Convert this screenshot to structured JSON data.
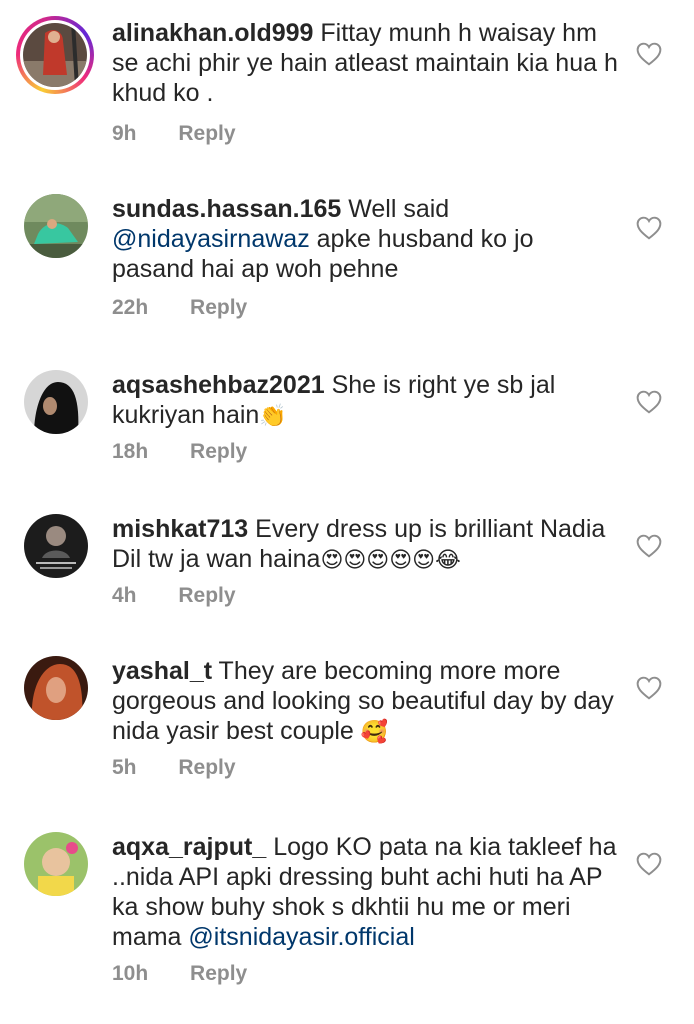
{
  "comments": [
    {
      "username": "alinakhan.old999",
      "text": " Fittay munh h waisay hm se achi phir ye hain atleast maintain kia hua h khud ko .",
      "time": "9h",
      "reply": "Reply",
      "avatar_colors": [
        "#3b2f2a",
        "#c0392b"
      ]
    },
    {
      "username": "sundas.hassan.165",
      "text_before": " Well said ",
      "mention": "@nidayasirnawaz",
      "text_after": " apke husband ko jo pasand hai ap woh pehne",
      "time": "22h",
      "reply": "Reply",
      "avatar_colors": [
        "#4e6b4a",
        "#38c7a0"
      ]
    },
    {
      "username": "aqsashehbaz2021",
      "text": " She is right ye sb jal kukriyan hain",
      "emoji": "👏",
      "time": "18h",
      "reply": "Reply",
      "avatar_colors": [
        "#cfcfcf",
        "#111111"
      ]
    },
    {
      "username": "mishkat713",
      "text": " Every dress up is brilliant Nadia Dil tw ja wan haina",
      "emoji": "😍😍😍😍😍😂",
      "time": "4h",
      "reply": "Reply",
      "avatar_colors": [
        "#1c1c1c",
        "#8a8a8a"
      ]
    },
    {
      "username": "yashal_t",
      "text": " They are becoming more more gorgeous and looking so beautiful day by day nida yasir best couple ",
      "emoji": "🥰",
      "time": "5h",
      "reply": "Reply",
      "avatar_colors": [
        "#5a2a1a",
        "#c0532b"
      ]
    },
    {
      "username": "aqxa_rajput_",
      "text_before": " Logo KO pata na kia takleef ha ..nida API apki dressing buht achi huti ha AP ka show buhy shok s dkhtii hu me or meri mama ",
      "mention": "@itsnidayasir.official",
      "text_after": "",
      "time": "10h",
      "reply": "Reply",
      "avatar_colors": [
        "#7fb04a",
        "#e8c39e"
      ]
    }
  ],
  "colors": {
    "text": "#262626",
    "meta": "#8e8e8e",
    "mention": "#00376b"
  },
  "icons": {
    "like": "heart-outline-icon"
  }
}
